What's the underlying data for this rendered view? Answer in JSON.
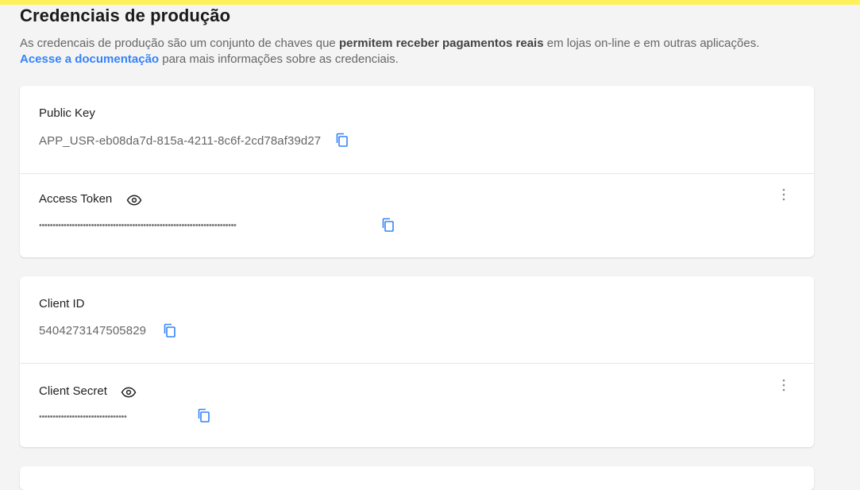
{
  "header": {
    "title": "Credenciais de produção",
    "desc_part1": "As credencais de produção são um conjunto de chaves que ",
    "desc_bold": "permitem receber pagamentos reais",
    "desc_part2": " em lojas on-line e em outras aplicações.",
    "doc_link": "Acesse a documentação",
    "desc_part3": " para mais informações sobre as credenciais."
  },
  "credentials": {
    "public_key": {
      "label": "Public Key",
      "value": "APP_USR-eb08da7d-815a-4211-8c6f-2cd78af39d27"
    },
    "access_token": {
      "label": "Access Token",
      "masked": "••••••••••••••••••••••••••••••••••••••••••••••••••••••••••••••••••••••••"
    },
    "client_id": {
      "label": "Client ID",
      "value": "5404273147505829"
    },
    "client_secret": {
      "label": "Client Secret",
      "masked": "••••••••••••••••••••••••••••••••"
    }
  },
  "colors": {
    "accent_yellow": "#fff159",
    "link_blue": "#3483fa",
    "background": "#f4f4f4"
  },
  "icons": {
    "copy": "copy-icon",
    "eye": "eye-icon",
    "kebab": "kebab-menu-icon"
  }
}
